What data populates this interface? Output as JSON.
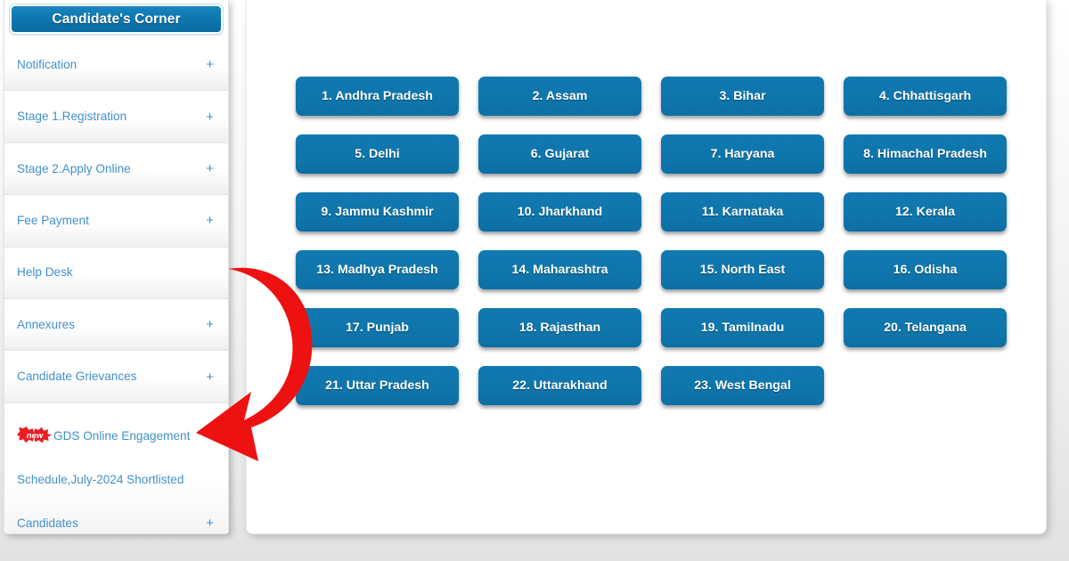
{
  "sidebar": {
    "header_title": "Candidate's Corner",
    "accent_color": "#0f75ae",
    "link_color": "#4190cc",
    "items": [
      {
        "label": "Notification",
        "expander": "+"
      },
      {
        "label": "Stage 1.Registration",
        "expander": "+"
      },
      {
        "label": "Stage 2.Apply Online",
        "expander": "+"
      },
      {
        "label": "Fee Payment",
        "expander": "+"
      },
      {
        "label": "Help Desk",
        "expander": ""
      },
      {
        "label": "Annexures",
        "expander": "+"
      },
      {
        "label": "Candidate Grievances",
        "expander": "+"
      },
      {
        "label": "GDS Online Engagement Schedule,July-2024 Shortlisted Candidates",
        "expander": "+",
        "badge": "new",
        "badge_icon": "new-starburst-badge"
      }
    ]
  },
  "content": {
    "button_color": "#0f76ac",
    "states": [
      {
        "label": "1. Andhra Pradesh"
      },
      {
        "label": "2. Assam"
      },
      {
        "label": "3. Bihar"
      },
      {
        "label": "4. Chhattisgarh"
      },
      {
        "label": "5. Delhi"
      },
      {
        "label": "6. Gujarat"
      },
      {
        "label": "7. Haryana"
      },
      {
        "label": "8. Himachal Pradesh"
      },
      {
        "label": "9. Jammu Kashmir"
      },
      {
        "label": "10. Jharkhand"
      },
      {
        "label": "11. Karnataka"
      },
      {
        "label": "12. Kerala"
      },
      {
        "label": "13. Madhya Pradesh"
      },
      {
        "label": "14. Maharashtra"
      },
      {
        "label": "15. North East"
      },
      {
        "label": "16. Odisha"
      },
      {
        "label": "17. Punjab"
      },
      {
        "label": "18. Rajasthan"
      },
      {
        "label": "19. Tamilnadu"
      },
      {
        "label": "20. Telangana"
      },
      {
        "label": "21. Uttar Pradesh"
      },
      {
        "label": "22. Uttarakhand"
      },
      {
        "label": "23. West Bengal"
      }
    ]
  },
  "annotation": {
    "arrow_icon": "curved-arrow-icon",
    "arrow_color": "#ee1111"
  }
}
